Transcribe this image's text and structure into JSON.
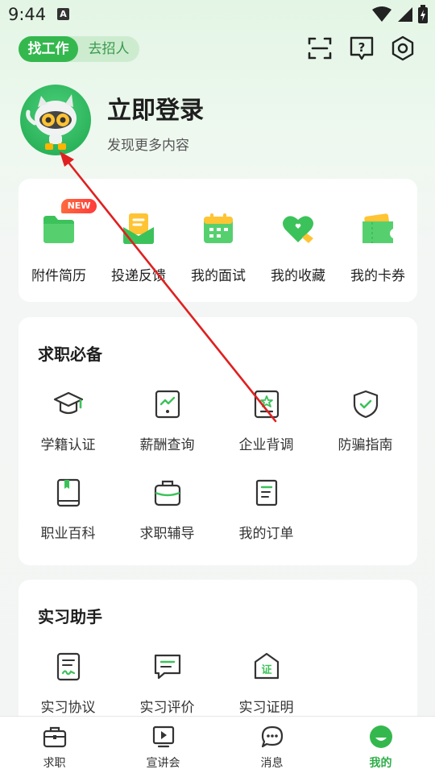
{
  "status_bar": {
    "time": "9:44",
    "badge": "A"
  },
  "header": {
    "role_toggle": {
      "active": "找工作",
      "inactive": "去招人"
    },
    "icons": [
      "scan-icon",
      "help-icon",
      "settings-icon"
    ]
  },
  "profile": {
    "title": "立即登录",
    "subtitle": "发现更多内容"
  },
  "quick_actions": {
    "new_badge": "NEW",
    "items": [
      {
        "label": "附件简历",
        "icon": "folder-icon"
      },
      {
        "label": "投递反馈",
        "icon": "envelope-icon"
      },
      {
        "label": "我的面试",
        "icon": "calendar-icon"
      },
      {
        "label": "我的收藏",
        "icon": "heart-icon"
      },
      {
        "label": "我的卡券",
        "icon": "coupon-icon"
      }
    ]
  },
  "job_essentials": {
    "title": "求职必备",
    "items": [
      {
        "label": "学籍认证",
        "icon": "graduation-cap-icon"
      },
      {
        "label": "薪酬查询",
        "icon": "salary-chart-icon"
      },
      {
        "label": "企业背调",
        "icon": "company-check-icon"
      },
      {
        "label": "防骗指南",
        "icon": "shield-check-icon"
      },
      {
        "label": "职业百科",
        "icon": "book-icon"
      },
      {
        "label": "求职辅导",
        "icon": "briefcase-icon"
      },
      {
        "label": "我的订单",
        "icon": "order-icon"
      }
    ]
  },
  "internship": {
    "title": "实习助手",
    "items": [
      {
        "label": "实习协议",
        "icon": "agreement-icon"
      },
      {
        "label": "实习评价",
        "icon": "comment-icon"
      },
      {
        "label": "实习证明",
        "icon": "certificate-icon"
      }
    ]
  },
  "tab_bar": {
    "tabs": [
      {
        "label": "求职",
        "icon": "briefcase-icon"
      },
      {
        "label": "宣讲会",
        "icon": "play-icon"
      },
      {
        "label": "消息",
        "icon": "chat-icon"
      },
      {
        "label": "我的",
        "icon": "profile-icon"
      }
    ],
    "active": "我的"
  },
  "colors": {
    "accent": "#34b84e",
    "annotation_arrow": "#e02020"
  }
}
